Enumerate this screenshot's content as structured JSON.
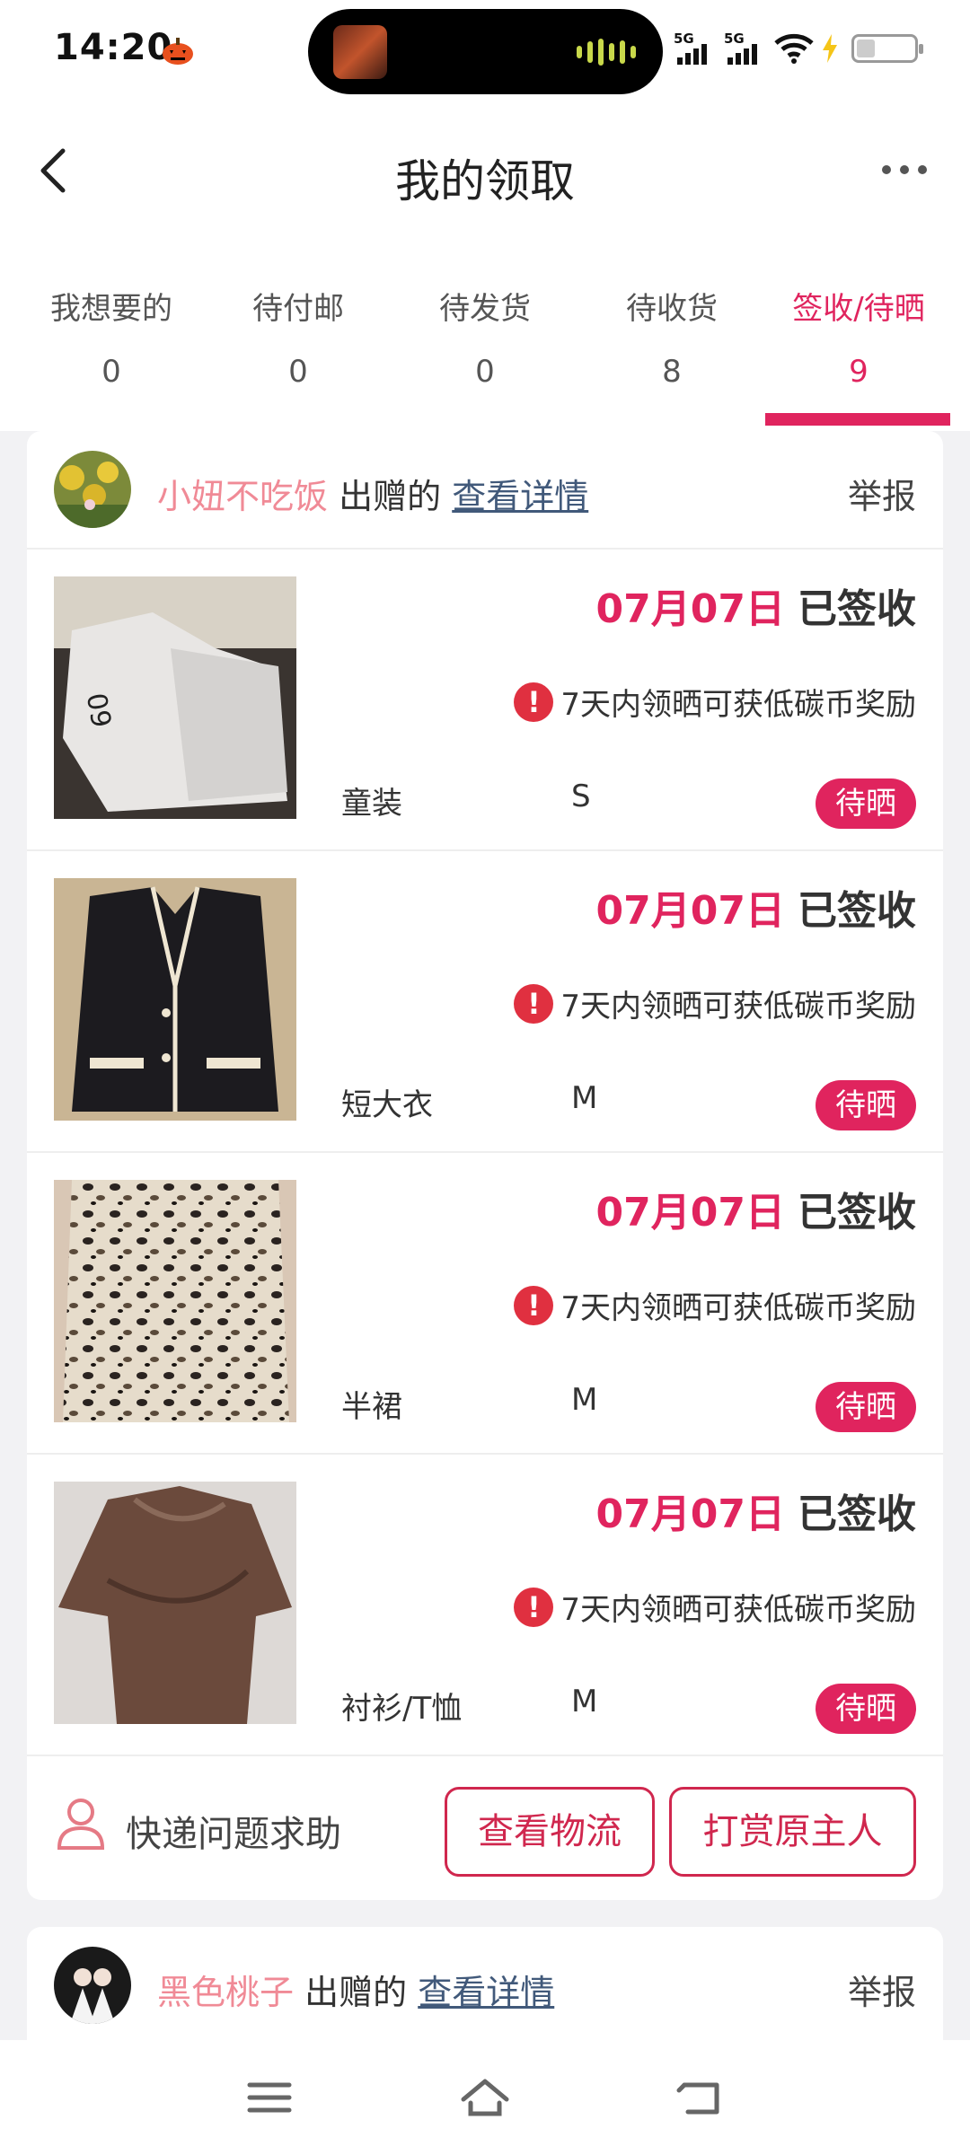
{
  "status_bar": {
    "time": "14:20",
    "signal_1": "5G",
    "signal_2": "5G"
  },
  "header": {
    "title": "我的领取"
  },
  "tabs": [
    {
      "label": "我想要的",
      "count": "0"
    },
    {
      "label": "待付邮",
      "count": "0"
    },
    {
      "label": "待发货",
      "count": "0"
    },
    {
      "label": "待收货",
      "count": "8"
    },
    {
      "label": "签收/待晒",
      "count": "9"
    }
  ],
  "active_tab_index": 4,
  "colors": {
    "accent": "#e0245e",
    "donor_name": "#f08a96",
    "link": "#41597a"
  },
  "orders": [
    {
      "donor_name": "小妞不吃饭",
      "donor_suffix": "出赠的",
      "details_link": "查看详情",
      "report_label": "举报",
      "items": [
        {
          "date": "07月07日",
          "status": "已签收",
          "notice": "7天内领晒可获低碳币奖励",
          "category": "童装",
          "size": "S",
          "badge": "待晒"
        },
        {
          "date": "07月07日",
          "status": "已签收",
          "notice": "7天内领晒可获低碳币奖励",
          "category": "短大衣",
          "size": "M",
          "badge": "待晒"
        },
        {
          "date": "07月07日",
          "status": "已签收",
          "notice": "7天内领晒可获低碳币奖励",
          "category": "半裙",
          "size": "M",
          "badge": "待晒"
        },
        {
          "date": "07月07日",
          "status": "已签收",
          "notice": "7天内领晒可获低碳币奖励",
          "category": "衬衫/T恤",
          "size": "M",
          "badge": "待晒"
        }
      ],
      "footer": {
        "help_label": "快递问题求助",
        "logistics_button": "查看物流",
        "tip_button": "打赏原主人"
      }
    },
    {
      "donor_name": "黑色桃子",
      "donor_suffix": "出赠的",
      "details_link": "查看详情",
      "report_label": "举报"
    }
  ],
  "icons": [
    "back-arrow-icon",
    "more-icon",
    "warning-icon",
    "person-icon",
    "menu-icon",
    "home-icon",
    "return-icon"
  ]
}
